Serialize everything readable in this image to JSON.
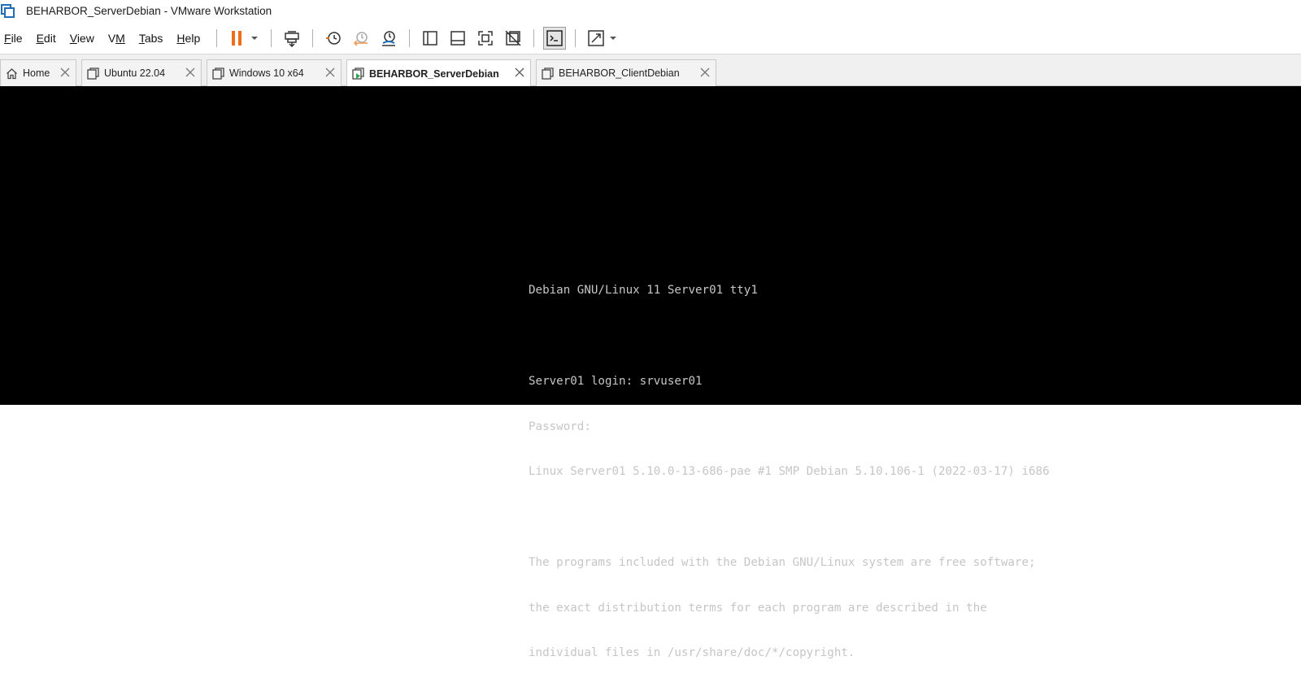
{
  "window": {
    "title": "BEHARBOR_ServerDebian - VMware Workstation",
    "app_icon": "vmware-icon"
  },
  "menu": {
    "items": [
      {
        "key": "F",
        "rest": "ile"
      },
      {
        "key": "E",
        "rest": "dit"
      },
      {
        "key": "V",
        "rest": "iew"
      },
      {
        "key": "V",
        "rest": "M",
        "pre": ""
      },
      {
        "key": "T",
        "rest": "abs"
      },
      {
        "key": "H",
        "rest": "elp"
      }
    ]
  },
  "toolbar": {
    "icons": [
      "pause-icon",
      "dropdown-icon",
      "send-ctrl-alt-del-icon",
      "snapshot-icon",
      "revert-snapshot-icon",
      "snapshot-manager-icon",
      "library-view-icon",
      "thumbnail-view-icon",
      "full-screen-icon",
      "unity-icon",
      "console-view-icon",
      "stretch-icon",
      "dropdown-icon"
    ],
    "accent_pause": "#ef6c1a"
  },
  "tabs": [
    {
      "label": "Home",
      "icon": "home-icon",
      "selected": false
    },
    {
      "label": "Ubuntu 22.04",
      "icon": "vm-icon",
      "selected": false
    },
    {
      "label": "Windows 10 x64",
      "icon": "vm-icon",
      "selected": false
    },
    {
      "label": "BEHARBOR_ServerDebian",
      "icon": "vm-running-icon",
      "selected": true
    },
    {
      "label": "BEHARBOR_ClientDebian",
      "icon": "vm-icon",
      "selected": false
    }
  ],
  "console": {
    "lines": [
      "Debian GNU/Linux 11 Server01 tty1",
      "",
      "Server01 login: srvuser01",
      "Password:",
      "Linux Server01 5.10.0-13-686-pae #1 SMP Debian 5.10.106-1 (2022-03-17) i686",
      "",
      "The programs included with the Debian GNU/Linux system are free software;",
      "the exact distribution terms for each program are described in the",
      "individual files in /usr/share/doc/*/copyright."
    ]
  }
}
